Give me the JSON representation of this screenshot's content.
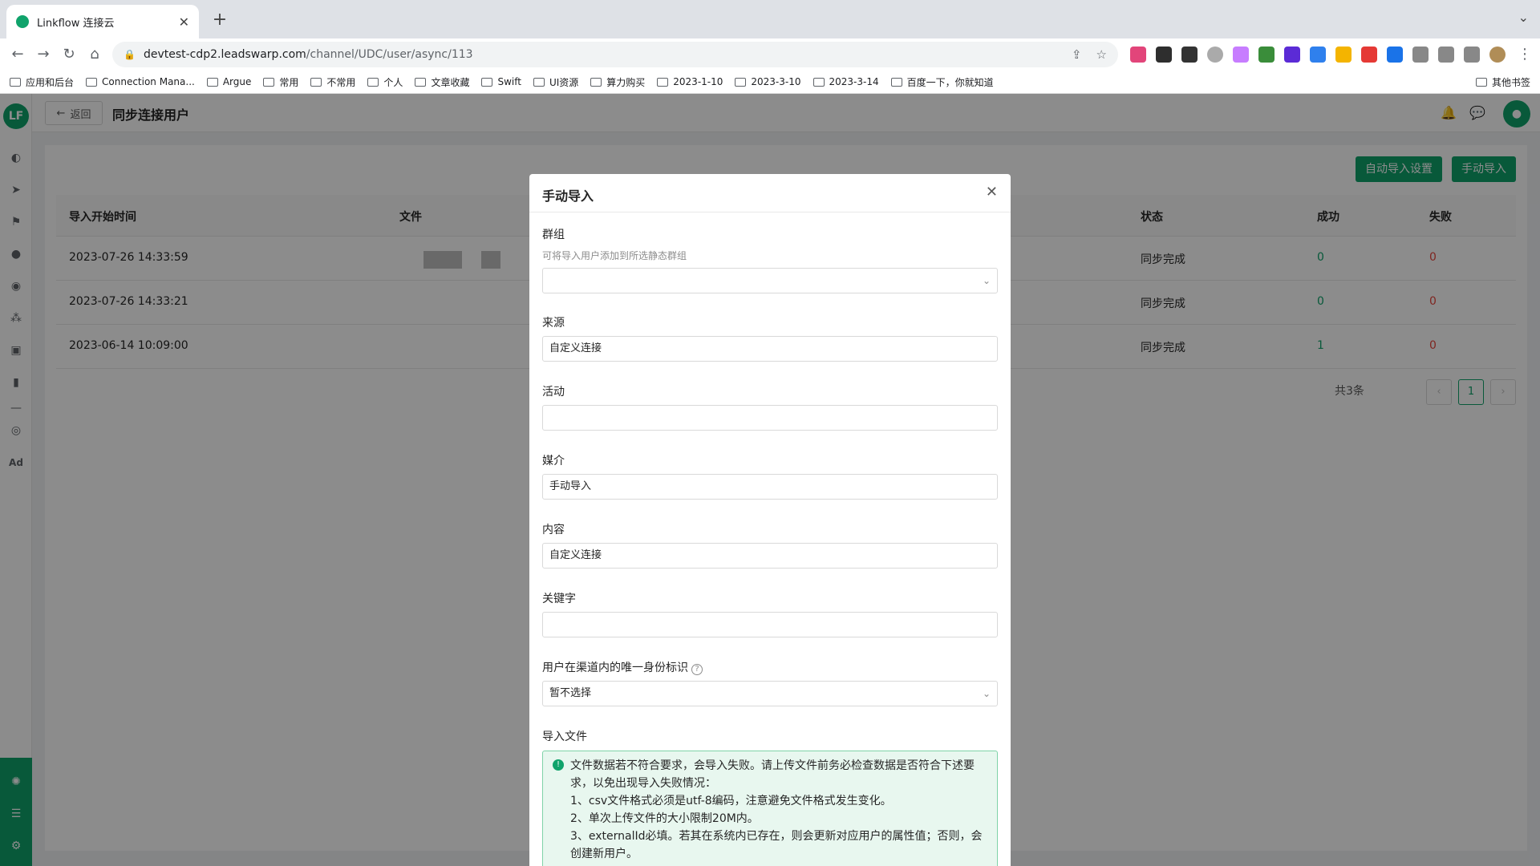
{
  "browser": {
    "tab_title": "Linkflow 连接云",
    "url_host": "devtest-cdp2.leadswarp.com",
    "url_path": "/channel/UDC/user/async/113",
    "bookmarks": [
      "应用和后台",
      "Connection Mana...",
      "Argue",
      "常用",
      "不常用",
      "个人",
      "文章收藏",
      "Swift",
      "UI资源",
      "算力购买",
      "2023-1-10",
      "2023-3-10",
      "2023-3-14",
      "百度一下，你就知道"
    ],
    "other_bookmarks": "其他书签"
  },
  "app": {
    "logo_text": "LF",
    "back_label": "返回",
    "page_title": "同步连接用户",
    "auto_import_label": "自动导入设置",
    "manual_import_label": "手动导入",
    "columns": {
      "start_time": "导入开始时间",
      "file": "文件",
      "status": "状态",
      "success": "成功",
      "fail": "失败"
    },
    "rows": [
      {
        "start_time": "2023-07-26 14:33:59",
        "status": "同步完成",
        "success": "0",
        "fail": "0"
      },
      {
        "start_time": "2023-07-26 14:33:21",
        "status": "同步完成",
        "success": "0",
        "fail": "0"
      },
      {
        "start_time": "2023-06-14 10:09:00",
        "status": "同步完成",
        "success": "1",
        "fail": "0"
      }
    ],
    "pager_total": "共3条",
    "pager_current": "1",
    "sidebar_ad": "Ad"
  },
  "modal": {
    "title": "手动导入",
    "group_label": "群组",
    "group_hint": "可将导入用户添加到所选静态群组",
    "source_label": "来源",
    "source_value": "自定义连接",
    "campaign_label": "活动",
    "campaign_value": "",
    "medium_label": "媒介",
    "medium_value": "手动导入",
    "content_label": "内容",
    "content_value": "自定义连接",
    "keyword_label": "关键字",
    "keyword_value": "",
    "identity_label": "用户在渠道内的唯一身份标识",
    "identity_value": "暂不选择",
    "file_label": "导入文件",
    "alert_lines": [
      "文件数据若不符合要求，会导入失败。请上传文件前务必检查数据是否符合下述要求，以免出现导入失败情况：",
      "1、csv文件格式必须是utf-8编码，注意避免文件格式发生变化。",
      "2、单次上传文件的大小限制20M内。",
      "3、externalId必填。若其在系统内已存在，则会更新对应用户的属性值；否则，会创建新用户。"
    ]
  },
  "colors": {
    "brand": "#10a36b",
    "fail": "#e8453c"
  }
}
